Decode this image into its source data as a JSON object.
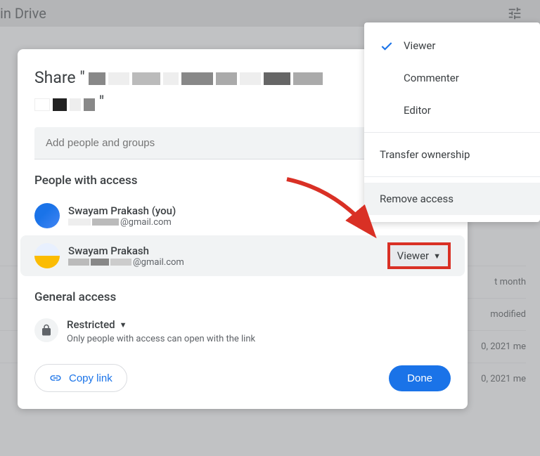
{
  "backdrop": {
    "title": "in Drive",
    "items": [
      "t month",
      "modified",
      "0, 2021 me",
      "0, 2021 me"
    ]
  },
  "share": {
    "title_prefix": "Share \"",
    "title_suffix": "\"",
    "add_placeholder": "Add people and groups",
    "people_section": "People with access",
    "people": [
      {
        "name": "Swayam Prakash (you)",
        "email_domain": "@gmail.com"
      },
      {
        "name": "Swayam Prakash",
        "email_domain": "@gmail.com",
        "role": "Viewer"
      }
    ],
    "general_section": "General access",
    "general_label": "Restricted",
    "general_desc": "Only people with access can open with the link",
    "copy_link": "Copy link",
    "done": "Done"
  },
  "menu": {
    "viewer": "Viewer",
    "commenter": "Commenter",
    "editor": "Editor",
    "transfer": "Transfer ownership",
    "remove": "Remove access"
  }
}
